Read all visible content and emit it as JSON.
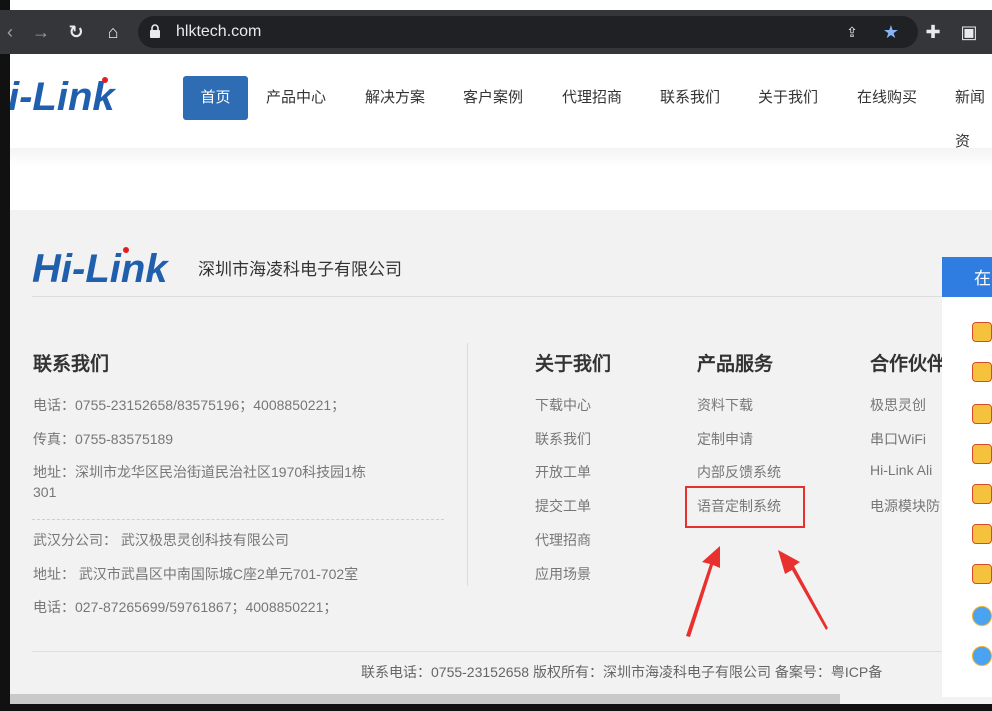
{
  "browser": {
    "url": "hlktech.com",
    "icons": [
      "back-arrow-icon",
      "forward-arrow-icon",
      "reload-icon",
      "home-icon",
      "lock-icon",
      "share-icon",
      "star-icon",
      "extensions-icon",
      "window-icon"
    ]
  },
  "header": {
    "logo_text": "i-Link",
    "nav": [
      "首页",
      "产品中心",
      "解决方案",
      "客户案例",
      "代理招商",
      "联系我们",
      "关于我们",
      "在线购买",
      "新闻资"
    ]
  },
  "footer": {
    "logo_text": "Hi-Link",
    "company_name": "深圳市海凌科电子有限公司",
    "contact": {
      "title": "联系我们",
      "phone": "电话：0755-23152658/83575196；4008850221；",
      "fax": "传真：0755-83575189",
      "address_line1": "地址：深圳市龙华区民治街道民治社区1970科技园1栋",
      "address_line2": "301",
      "wuhan_branch": "武汉分公司：  武汉极思灵创科技有限公司",
      "wuhan_address": "地址：  武汉市武昌区中南国际城C座2单元701-702室",
      "wuhan_phone": "电话：027-87265699/59761867；4008850221；"
    },
    "about": {
      "title": "关于我们",
      "links": [
        "下载中心",
        "联系我们",
        "开放工单",
        "提交工单",
        "代理招商",
        "应用场景"
      ]
    },
    "services": {
      "title": "产品服务",
      "links": [
        "资料下载",
        "定制申请",
        "内部反馈系统",
        "语音定制系统"
      ]
    },
    "partners": {
      "title": "合作伙伴",
      "links": [
        "极思灵创",
        "串口WiFi",
        "Hi-Link Ali",
        "电源模块防"
      ]
    },
    "copyright": "联系电话：0755-23152658 版权所有：深圳市海凌科电子有限公司 备案号：粤ICP备"
  },
  "online_widget": {
    "title": "在"
  },
  "colors": {
    "nav_active": "#2e6db4",
    "logo_blue": "#1f5fae",
    "logo_red": "#e02020",
    "highlight_red": "#e8312f",
    "widget_blue": "#2f7de1"
  }
}
